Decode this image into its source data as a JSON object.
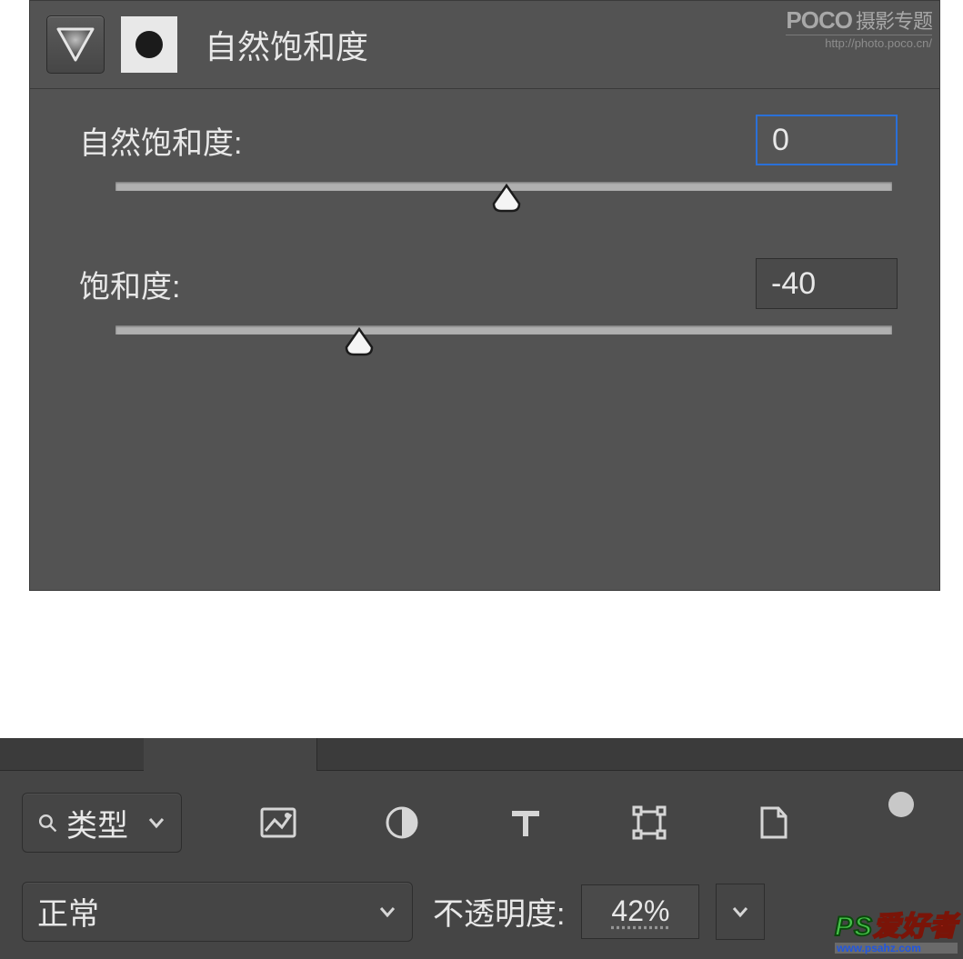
{
  "panel1": {
    "title": "自然饱和度",
    "poco": {
      "brand": "POCO",
      "suffix": "摄影专题",
      "url": "http://photo.poco.cn/"
    },
    "sliders": {
      "vibrance": {
        "label": "自然饱和度:",
        "value": "0",
        "thumb_pct": 48
      },
      "saturation": {
        "label": "饱和度:",
        "value": "-40",
        "thumb_pct": 29
      }
    }
  },
  "panel2": {
    "filter": {
      "label": "类型"
    },
    "blend": {
      "mode": "正常",
      "opacity_label": "不透明度:",
      "opacity_value": "42%"
    }
  },
  "psahz": {
    "ps": "PS",
    "rest": "爱好者",
    "url": "www.psahz.com"
  }
}
